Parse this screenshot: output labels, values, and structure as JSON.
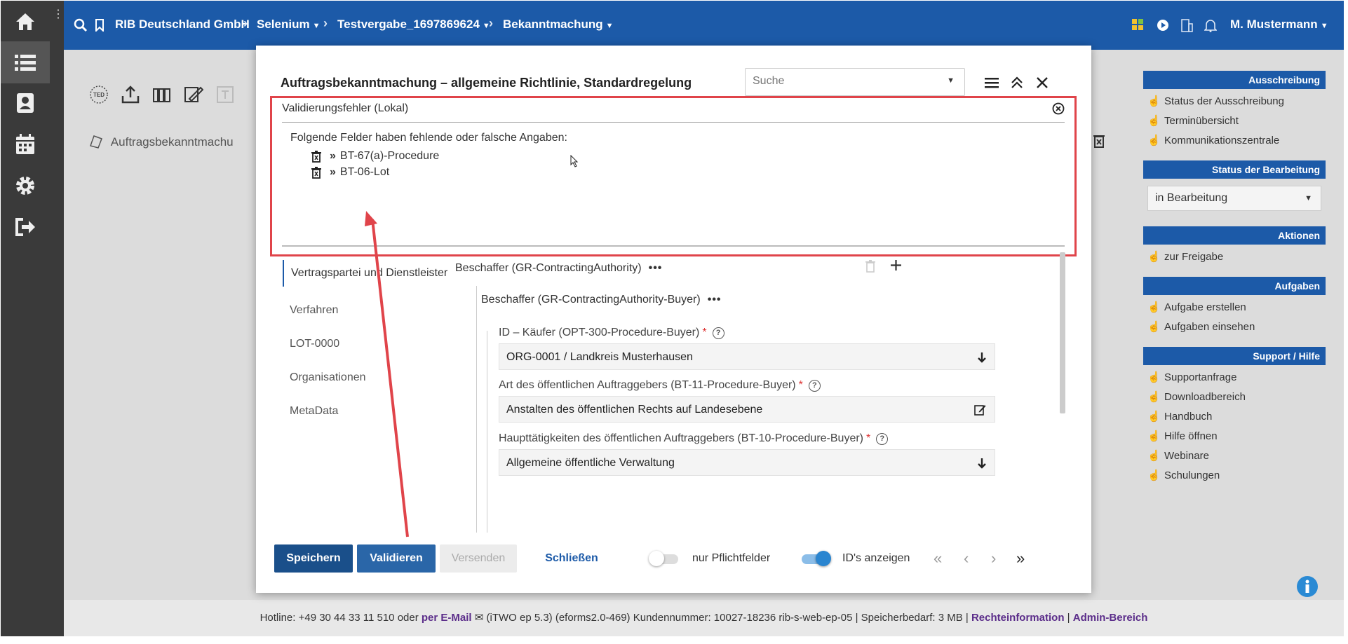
{
  "topbar": {
    "org": "RIB Deutschland GmbH",
    "project": "Selenium",
    "tender": "Testvergabe_1697869624",
    "section": "Bekanntmachung",
    "user": "M. Mustermann"
  },
  "background": {
    "file_name": "Auftragsbekanntmachu",
    "toolbar_icons": [
      "ted-icon",
      "upload-icon",
      "archive-icon",
      "signature-icon",
      "text-icon"
    ]
  },
  "right_panel": {
    "ausschreibung": {
      "title": "Ausschreibung",
      "items": [
        "Status der Ausschreibung",
        "Terminübersicht",
        "Kommunikationszentrale"
      ]
    },
    "status": {
      "title": "Status der Bearbeitung",
      "selected": "in Bearbeitung"
    },
    "aktionen": {
      "title": "Aktionen",
      "items": [
        "zur Freigabe"
      ]
    },
    "aufgaben": {
      "title": "Aufgaben",
      "items": [
        "Aufgabe erstellen",
        "Aufgaben einsehen"
      ]
    },
    "support": {
      "title": "Support / Hilfe",
      "items": [
        "Supportanfrage",
        "Downloadbereich",
        "Handbuch",
        "Hilfe öffnen",
        "Webinare",
        "Schulungen"
      ]
    }
  },
  "footer": {
    "hotline": "Hotline: +49 30 44 33 11 510 oder",
    "email_link": "per E-Mail",
    "version": "(iTWO ep 5.3) (eforms2.0-469)",
    "customer": "Kundennummer: 10027-18236 rib-s-web-ep-05 | Speicherbedarf: 3 MB |",
    "legal_link": "Rechteinformation",
    "divider": "|",
    "admin_link": "Admin-Bereich"
  },
  "modal": {
    "title": "Auftragsbekanntmachung – allgemeine Richtlinie, Standardregelung",
    "search_placeholder": "Suche",
    "validation": {
      "title": "Validierungsfehler (Lokal)",
      "intro": "Folgende Felder haben fehlende oder falsche Angaben:",
      "items": [
        "BT-67(a)-Procedure",
        "BT-06-Lot"
      ]
    },
    "tabs": [
      "Vertragspartei und Dienstleister",
      "Verfahren",
      "LOT-0000",
      "Organisationen",
      "MetaData"
    ],
    "content": {
      "group1": "Beschaffer (GR-ContractingAuthority)",
      "group2": "Beschaffer (GR-ContractingAuthority-Buyer)",
      "more_dots": "•••",
      "fields": [
        {
          "label": "ID – Käufer (OPT-300-Procedure-Buyer)",
          "required": "*",
          "value": "ORG-0001 / Landkreis Musterhausen"
        },
        {
          "label": "Art des öffentlichen Auftraggebers (BT-11-Procedure-Buyer)",
          "required": "*",
          "value": "Anstalten des öffentlichen Rechts auf Landesebene"
        },
        {
          "label": "Haupttätigkeiten des öffentlichen Auftraggebers (BT-10-Procedure-Buyer)",
          "required": "*",
          "value": "Allgemeine öffentliche Verwaltung"
        }
      ]
    },
    "footer": {
      "save": "Speichern",
      "validate": "Validieren",
      "send": "Versenden",
      "close": "Schließen",
      "only_required": "nur Pflichtfelder",
      "show_ids": "ID's anzeigen",
      "only_required_on": false,
      "show_ids_on": true
    }
  },
  "colors": {
    "brand": "#1c5aa8",
    "primary_button": "#1a4f8a",
    "highlight": "#e0444a",
    "sidebar": "#3a3a3a"
  }
}
